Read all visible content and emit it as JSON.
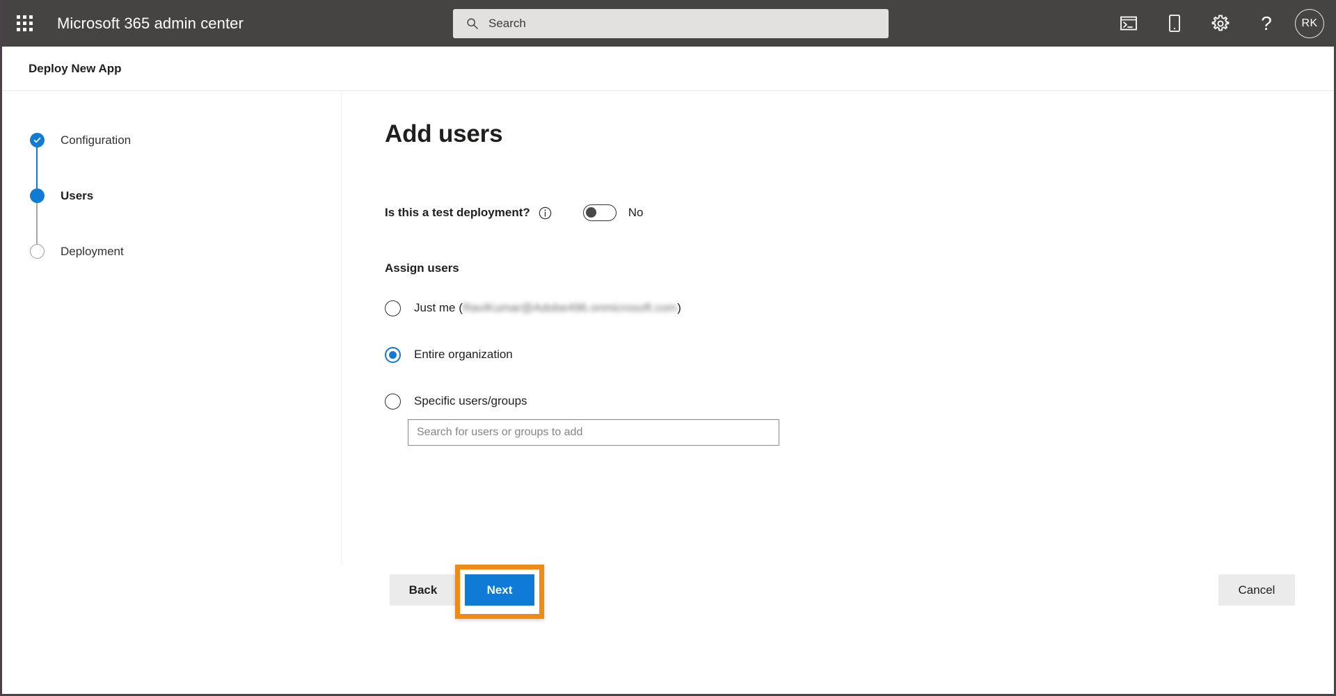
{
  "suitebar": {
    "waffle_name": "app-launcher",
    "brand": "Microsoft 365 admin center",
    "search": {
      "placeholder": "Search",
      "value": "",
      "icon": "search-icon"
    },
    "icons": [
      {
        "name": "console-icon",
        "label": "Cloud Shell"
      },
      {
        "name": "mobile-device-icon",
        "label": "Mobile app"
      },
      {
        "name": "gear-icon",
        "label": "Settings"
      },
      {
        "name": "help-icon",
        "label": "?"
      }
    ],
    "avatar": {
      "initials": "RK",
      "name": "account-avatar"
    },
    "background": "#464443"
  },
  "command_bar": {
    "title": "Deploy New App"
  },
  "stepper": {
    "steps": [
      {
        "label": "Configuration",
        "state": "completed"
      },
      {
        "label": "Users",
        "state": "active"
      },
      {
        "label": "Deployment",
        "state": "pending"
      }
    ]
  },
  "main": {
    "heading": "Add users",
    "test_deployment": {
      "question": "Is this a test deployment?",
      "info_icon": "info-icon",
      "toggle_state": "off",
      "toggle_value": "No"
    },
    "assign_users": {
      "section_label": "Assign users",
      "options": [
        {
          "label_prefix": "Just me (",
          "redacted_value": "RaviKumar@Adobe496.onmicrosoft.com",
          "label_suffix": ")",
          "selected": false
        },
        {
          "label": "Entire organization",
          "selected": true
        },
        {
          "label": "Specific users/groups",
          "selected": false
        }
      ],
      "search_users": {
        "placeholder": "Search for users or groups to add",
        "value": ""
      }
    }
  },
  "footer": {
    "back_label": "Back",
    "next_label": "Next",
    "cancel_label": "Cancel"
  },
  "colors": {
    "accent_blue": "#0f7bd6",
    "suitebar": "#464443",
    "highlight_orange": "#ef8a16",
    "neutral_button": "#ebebeb"
  }
}
